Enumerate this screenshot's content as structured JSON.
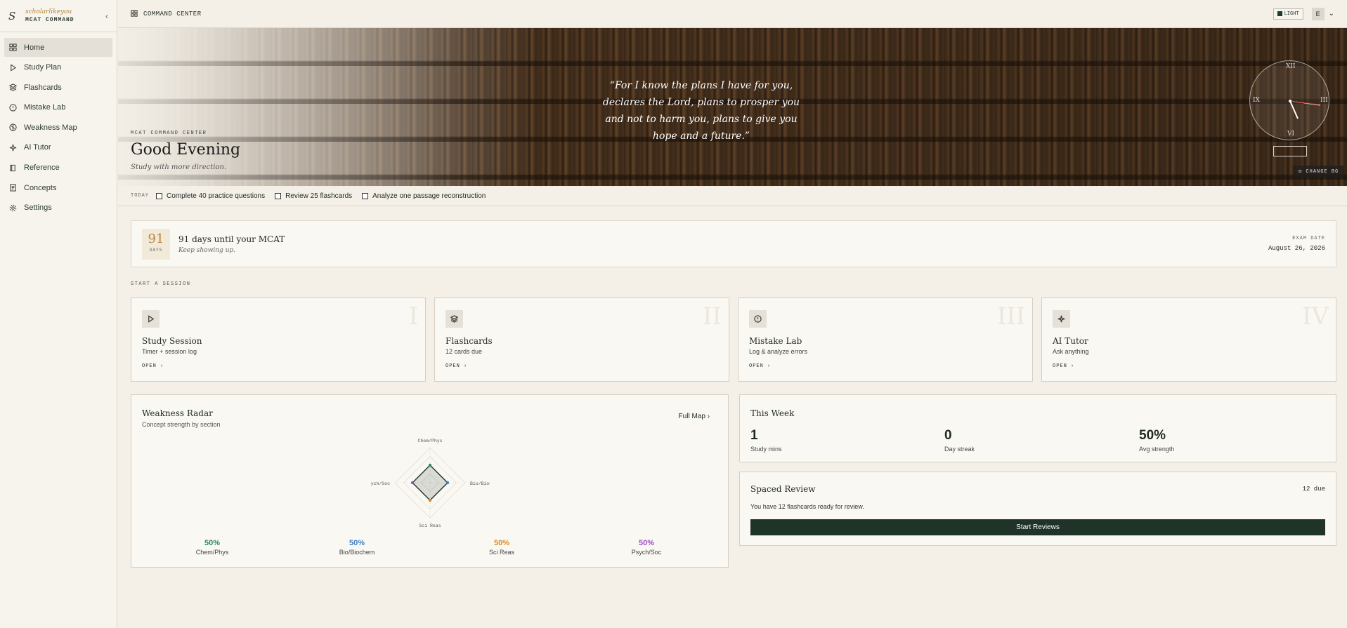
{
  "brand": {
    "logo": "S",
    "top": "scholarlikeyou",
    "bottom": "MCAT COMMAND"
  },
  "sidebar": {
    "items": [
      {
        "label": "Home",
        "icon": "home-icon"
      },
      {
        "label": "Study Plan",
        "icon": "play-icon"
      },
      {
        "label": "Flashcards",
        "icon": "layers-icon"
      },
      {
        "label": "Mistake Lab",
        "icon": "alert-icon"
      },
      {
        "label": "Weakness Map",
        "icon": "compass-icon"
      },
      {
        "label": "AI Tutor",
        "icon": "sparkle-icon"
      },
      {
        "label": "Reference",
        "icon": "book-icon"
      },
      {
        "label": "Concepts",
        "icon": "document-icon"
      },
      {
        "label": "Settings",
        "icon": "gear-icon"
      }
    ]
  },
  "topbar": {
    "title": "COMMAND CENTER",
    "theme_label": "LIGHT",
    "avatar": "E"
  },
  "hero": {
    "quote": "“For I know the plans I have for you, declares the Lord, plans to prosper you and not to harm you, plans to give you hope and a future.”",
    "kicker": "MCAT COMMAND CENTER",
    "title": "Good Evening",
    "subtitle": "Study with more direction.",
    "clock": {
      "xii": "XII",
      "iii": "III",
      "vi": "VI",
      "ix": "IX"
    },
    "change_bg": "CHANGE BG"
  },
  "today": {
    "label": "TODAY",
    "tasks": [
      "Complete 40 practice questions",
      "Review 25 flashcards",
      "Analyze one passage reconstruction"
    ]
  },
  "countdown": {
    "days": "91",
    "days_label": "DAYS",
    "title": "91 days until your MCAT",
    "subtitle": "Keep showing up.",
    "exam_label": "EXAM DATE",
    "exam_date": "August 26, 2026"
  },
  "sessions": {
    "label": "START A SESSION",
    "cards": [
      {
        "roman": "I",
        "title": "Study Session",
        "sub": "Timer + session log",
        "open": "OPEN ›"
      },
      {
        "roman": "II",
        "title": "Flashcards",
        "sub": "12 cards due",
        "open": "OPEN ›"
      },
      {
        "roman": "III",
        "title": "Mistake Lab",
        "sub": "Log & analyze errors",
        "open": "OPEN ›"
      },
      {
        "roman": "IV",
        "title": "AI Tutor",
        "sub": "Ask anything",
        "open": "OPEN ›"
      }
    ]
  },
  "radar": {
    "title": "Weakness Radar",
    "subtitle": "Concept strength by section",
    "full_map": "Full Map ›",
    "axes": [
      "Chem/Phys",
      "Bio/Biochem",
      "Sci Reas",
      "Psych/Soc"
    ],
    "stats": [
      {
        "value": "50%",
        "label": "Chem/Phys",
        "color": "#2e8a5e"
      },
      {
        "value": "50%",
        "label": "Bio/Biochem",
        "color": "#3f7fc4"
      },
      {
        "value": "50%",
        "label": "Sci Reas",
        "color": "#d9892b"
      },
      {
        "value": "50%",
        "label": "Psych/Soc",
        "color": "#9b4fc2"
      }
    ]
  },
  "week": {
    "title": "This Week",
    "stats": [
      {
        "value": "1",
        "label": "Study mins"
      },
      {
        "value": "0",
        "label": "Day streak"
      },
      {
        "value": "50%",
        "label": "Avg strength"
      }
    ]
  },
  "review": {
    "title": "Spaced Review",
    "due": "12 due",
    "text": "You have 12 flashcards ready for review.",
    "button": "Start Reviews"
  },
  "chart_data": {
    "type": "radar",
    "categories": [
      "Chem/Phys",
      "Bio/Biochem",
      "Sci Reas",
      "Psych/Soc"
    ],
    "values": [
      50,
      50,
      50,
      50
    ],
    "ylim": [
      0,
      100
    ]
  }
}
